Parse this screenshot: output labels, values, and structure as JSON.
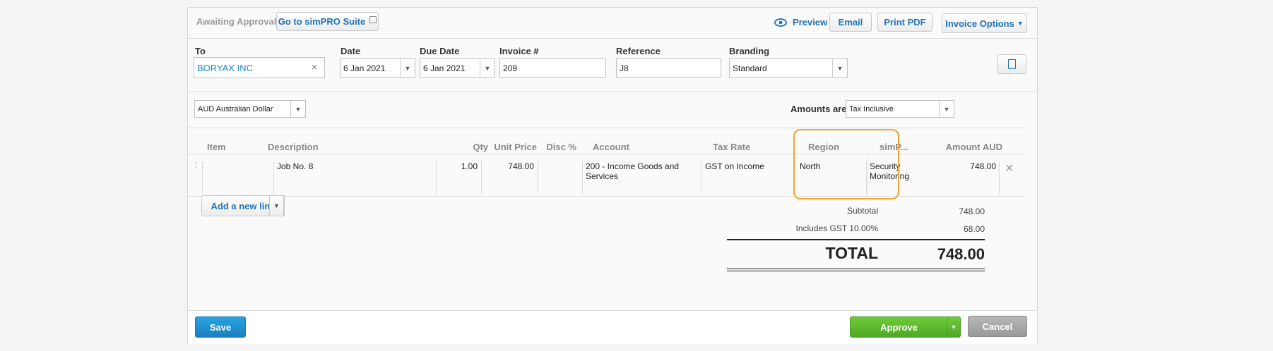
{
  "header": {
    "status": "Awaiting Approval",
    "suite_button": "Go to simPRO Suite",
    "preview": "Preview",
    "email": "Email",
    "print_pdf": "Print PDF",
    "invoice_options": "Invoice Options"
  },
  "form": {
    "to_label": "To",
    "to_value": "BORYAX INC",
    "date_label": "Date",
    "date_value": "6 Jan 2021",
    "due_label": "Due Date",
    "due_value": "6 Jan 2021",
    "invoice_label": "Invoice #",
    "invoice_value": "209",
    "reference_label": "Reference",
    "reference_value": "J8",
    "branding_label": "Branding",
    "branding_value": "Standard",
    "currency_value": "AUD Australian Dollar",
    "amounts_label": "Amounts are",
    "amounts_value": "Tax Inclusive"
  },
  "table": {
    "headers": {
      "item": "Item",
      "description": "Description",
      "qty": "Qty",
      "unit_price": "Unit Price",
      "disc": "Disc %",
      "account": "Account",
      "tax_rate": "Tax Rate",
      "region": "Region",
      "simpro": "simP...",
      "amount": "Amount AUD"
    },
    "rows": [
      {
        "item": "",
        "description": "Job No. 8",
        "qty": "1.00",
        "unit_price": "748.00",
        "disc": "",
        "account_line1": "200 - Income Goods and",
        "account_line2": "Services",
        "tax_rate": "GST on Income",
        "region": "North",
        "simpro_line1": "Security",
        "simpro_line2": "Monitoring",
        "amount": "748.00"
      }
    ]
  },
  "add_line": "Add a new line",
  "totals": {
    "subtotal_label": "Subtotal",
    "subtotal_value": "748.00",
    "gst_label": "Includes GST 10.00%",
    "gst_value": "68.00",
    "total_label": "TOTAL",
    "total_value": "748.00"
  },
  "footer": {
    "save": "Save",
    "approve": "Approve",
    "cancel": "Cancel"
  },
  "colors": {
    "highlight": "#f0a336",
    "approve": "#5cb82e",
    "save": "#1a88c7",
    "link": "#1f72b6"
  }
}
